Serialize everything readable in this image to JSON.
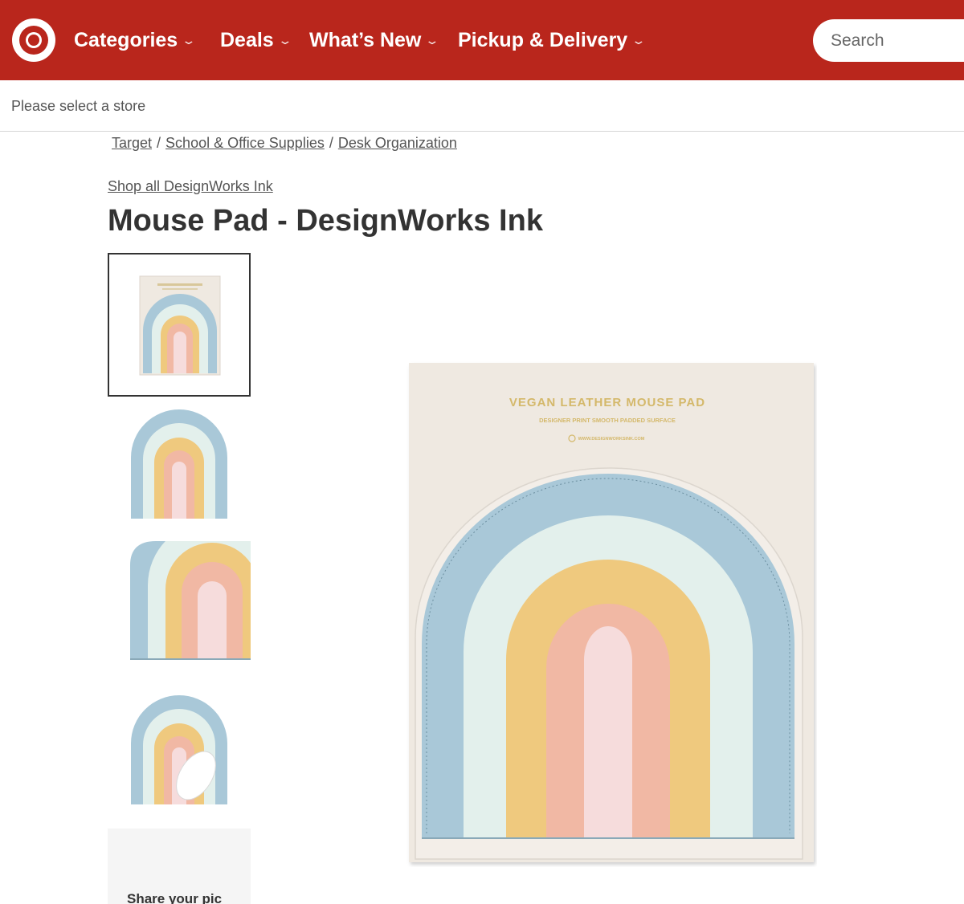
{
  "header": {
    "logo": "target-bullseye-logo",
    "nav": [
      {
        "label": "Categories",
        "icon": "chevron-down-icon"
      },
      {
        "label": "Deals",
        "icon": "chevron-down-icon"
      },
      {
        "label": "What’s New",
        "icon": "chevron-down-icon"
      },
      {
        "label": "Pickup & Delivery",
        "icon": "chevron-down-icon"
      }
    ],
    "search": {
      "placeholder": "Search"
    }
  },
  "store": {
    "label": "Please select a store"
  },
  "breadcrumb": [
    "Target",
    "School & Office Supplies",
    "Desk Organization"
  ],
  "product": {
    "brand_link": "Shop all DesignWorks Ink",
    "title": "Mouse Pad - DesignWorks Ink",
    "package_text": {
      "line1": "VEGAN LEATHER MOUSE PAD",
      "line2": "DESIGNER PRINT SMOOTH PADDED SURFACE",
      "line3": "WWW.DESIGNWORKSINK.COM"
    }
  },
  "gallery": {
    "share_label": "Share your pic"
  },
  "colors": {
    "brand_red": "#b9261c",
    "rainbow_blue": "#a9c8d8",
    "rainbow_mint": "#e3f0ec",
    "rainbow_yellow": "#efc97e",
    "rainbow_peach": "#f1b8a4",
    "rainbow_pink": "#f6dcdc",
    "package_cream": "#efe9e1"
  }
}
